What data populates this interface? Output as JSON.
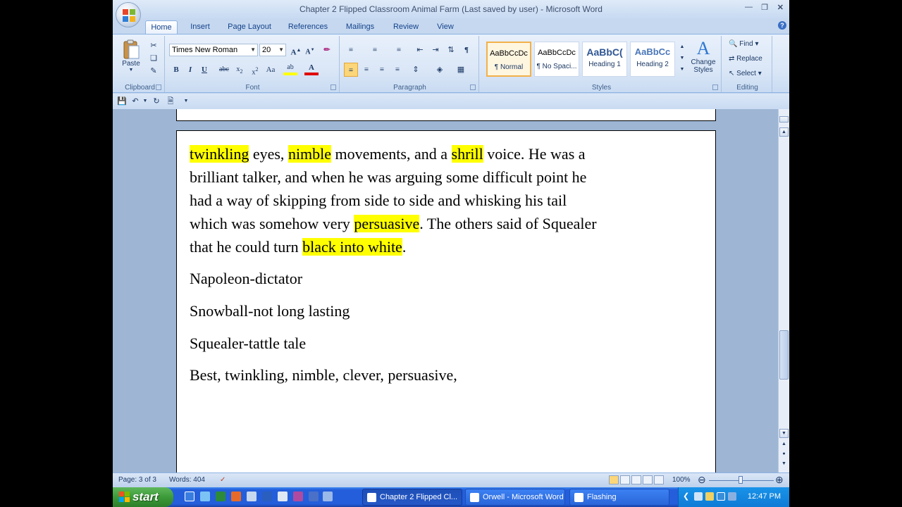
{
  "window": {
    "title": "Chapter 2 Flipped Classroom Animal Farm (Last saved by user) - Microsoft Word"
  },
  "tabs": [
    "Home",
    "Insert",
    "Page Layout",
    "References",
    "Mailings",
    "Review",
    "View"
  ],
  "active_tab": "Home",
  "ribbon": {
    "clipboard": {
      "label": "Clipboard",
      "paste_label": "Paste"
    },
    "font": {
      "label": "Font",
      "font_name": "Times New Roman",
      "font_size": "20"
    },
    "paragraph": {
      "label": "Paragraph"
    },
    "styles": {
      "label": "Styles",
      "items": [
        {
          "sample": "AaBbCcDc",
          "name": "¶ Normal",
          "selected": true
        },
        {
          "sample": "AaBbCcDc",
          "name": "¶ No Spaci..."
        },
        {
          "sample": "AaBbC(",
          "name": "Heading 1"
        },
        {
          "sample": "AaBbCc",
          "name": "Heading 2"
        }
      ],
      "change_styles_line1": "Change",
      "change_styles_line2": "Styles"
    },
    "editing": {
      "label": "Editing",
      "find": "Find",
      "replace": "Replace",
      "select": "Select"
    }
  },
  "document": {
    "paragraph1_lines": [
      [
        {
          "text": "twinkling",
          "highlight": true
        },
        {
          "text": " eyes, ",
          "highlight": false
        },
        {
          "text": "nimble",
          "highlight": true
        },
        {
          "text": " movements, and a ",
          "highlight": false
        },
        {
          "text": "shrill",
          "highlight": true
        },
        {
          "text": " voice. He was a",
          "highlight": false
        }
      ],
      [
        {
          "text": "brilliant talker, and when he was arguing some difficult point he",
          "highlight": false
        }
      ],
      [
        {
          "text": "had a way of skipping from side to side and whisking his tail",
          "highlight": false
        }
      ],
      [
        {
          "text": "which was somehow very ",
          "highlight": false
        },
        {
          "text": "persuasive",
          "highlight": true
        },
        {
          "text": ". The others said of Squealer",
          "highlight": false
        }
      ],
      [
        {
          "text": "that he could turn ",
          "highlight": false
        },
        {
          "text": "black into white",
          "highlight": true
        },
        {
          "text": ".",
          "highlight": false
        }
      ]
    ],
    "line_napoleon": "Napoleon-dictator",
    "line_snowball": "Snowball-not long lasting",
    "line_squealer": "Squealer-tattle tale",
    "line_words": "Best, twinkling, nimble, clever, persuasive,"
  },
  "statusbar": {
    "page": "Page: 3 of 3",
    "words": "Words: 404",
    "zoom": "100%"
  },
  "taskbar": {
    "start_label": "start",
    "tasks": [
      {
        "label": "Chapter 2 Flipped Cl...",
        "active": true
      },
      {
        "label": "Orwell - Microsoft Word",
        "active": false
      },
      {
        "label": "Flashing",
        "active": false
      }
    ],
    "clock": "12:47 PM"
  },
  "colors": {
    "highlight": "#ffff00",
    "ribbon_bg": "#dbe7f7",
    "taskbar_blue": "#245edb",
    "start_green": "#3c9a38"
  }
}
